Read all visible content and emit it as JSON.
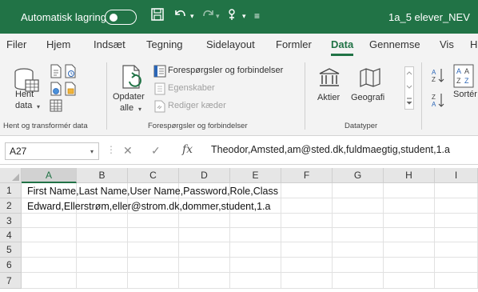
{
  "titlebar": {
    "autosave_label": "Automatisk lagring",
    "filename": "1a_5 elever_NEV"
  },
  "menu": {
    "tabs": [
      "Filer",
      "Hjem",
      "Indsæt",
      "Tegning",
      "Sidelayout",
      "Formler",
      "Data",
      "Gennemse",
      "Vis",
      "H"
    ],
    "active_tab": "Data"
  },
  "ribbon": {
    "get_data_label": "Hent",
    "get_data_label2": "data",
    "refresh_label": "Opdater",
    "refresh_label2": "alle",
    "queries_label": "Forespørgsler og forbindelser",
    "properties_label": "Egenskaber",
    "edit_links_label": "Rediger kæder",
    "stocks_label": "Aktier",
    "geography_label": "Geografi",
    "sort_label": "Sortér",
    "group_get_transform": "Hent og transformér data",
    "group_queries": "Forespørgsler og forbindelser",
    "group_datatypes": "Datatyper"
  },
  "formula_bar": {
    "cell_ref": "A27",
    "fx_label": "fx",
    "content": "Theodor,Amsted,am@sted.dk,fuldmaegtig,student,1.a"
  },
  "grid": {
    "columns": [
      "A",
      "B",
      "C",
      "D",
      "E",
      "F",
      "G",
      "H",
      "I"
    ],
    "selected_column": "A",
    "rows": [
      "1",
      "2",
      "3",
      "4",
      "5",
      "6",
      "7"
    ],
    "cells": {
      "row1": "First Name,Last Name,User Name,Password,Role,Class",
      "row2": "Edward,Ellerstrøm,eller@strom.dk,dommer,student,1.a"
    }
  },
  "colors": {
    "accent": "#217346",
    "ribbon_bg": "#f3f3f3",
    "header_bg": "#e6e6e6"
  }
}
